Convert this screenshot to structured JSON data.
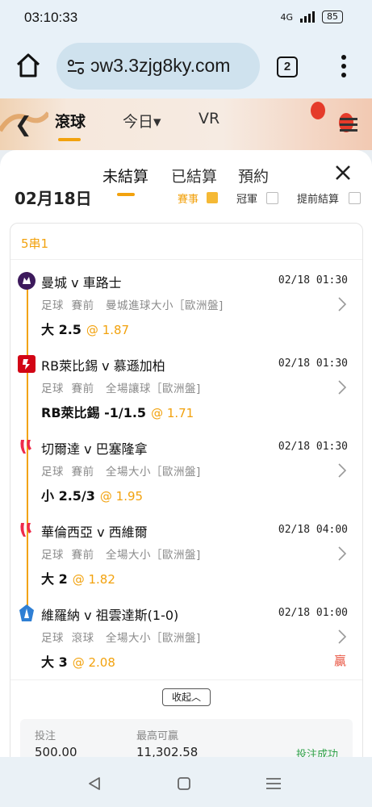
{
  "status_bar": {
    "time": "03:10:33",
    "network": "4G",
    "battery": "85"
  },
  "browser": {
    "url": "ɔw3.3zjg8ky.com",
    "tab_count": "2"
  },
  "site_nav": {
    "items": [
      "滾球",
      "今日▾",
      "VR"
    ]
  },
  "sheet": {
    "tabs": [
      "未結算",
      "已結算",
      "預約"
    ],
    "behind_filters": {
      "date": "02月18日",
      "f1": "賽事",
      "f2": "冠軍",
      "f3": "提前結算"
    },
    "card": {
      "title": "5串1",
      "legs": [
        {
          "logo": "premier-league",
          "match": "曼城 v 車路士",
          "time": "02/18 01:30",
          "sport": "足球",
          "stage": "賽前",
          "market": "曼城進球大小［歐洲盤]",
          "selection": "大 2.5",
          "odds": "@ 1.87",
          "result": ""
        },
        {
          "logo": "bundesliga",
          "match": "RB萊比錫 v 慕遜加柏",
          "time": "02/18 01:30",
          "sport": "足球",
          "stage": "賽前",
          "market": "全場讓球［歐洲盤]",
          "selection": "RB萊比錫 -1/1.5",
          "odds": "@ 1.71",
          "result": ""
        },
        {
          "logo": "laliga",
          "match": "切爾達 v 巴塞隆拿",
          "time": "02/18 01:30",
          "sport": "足球",
          "stage": "賽前",
          "market": "全場大小［歐洲盤]",
          "selection": "小 2.5/3",
          "odds": "@ 1.95",
          "result": ""
        },
        {
          "logo": "laliga",
          "match": "華倫西亞 v 西維爾",
          "time": "02/18 04:00",
          "sport": "足球",
          "stage": "賽前",
          "market": "全場大小［歐洲盤]",
          "selection": "大 2",
          "odds": "@ 1.82",
          "result": ""
        },
        {
          "logo": "serie-a",
          "match": "維羅納 v 祖雲達斯(1-0)",
          "time": "02/18 01:00",
          "sport": "足球",
          "stage": "滾球",
          "market": "全場大小［歐洲盤]",
          "selection": "大 3",
          "odds": "@ 2.08",
          "result": "贏"
        }
      ],
      "collapse_label": "收起︿",
      "summary": {
        "stake_label": "投注",
        "stake": "500.00",
        "max_win_label": "最高可贏",
        "max_win": "11,302.58",
        "status": "投注成功"
      }
    }
  },
  "colors": {
    "accent": "#f2a20e",
    "win": "#e8523f",
    "success": "#2fa24a"
  }
}
